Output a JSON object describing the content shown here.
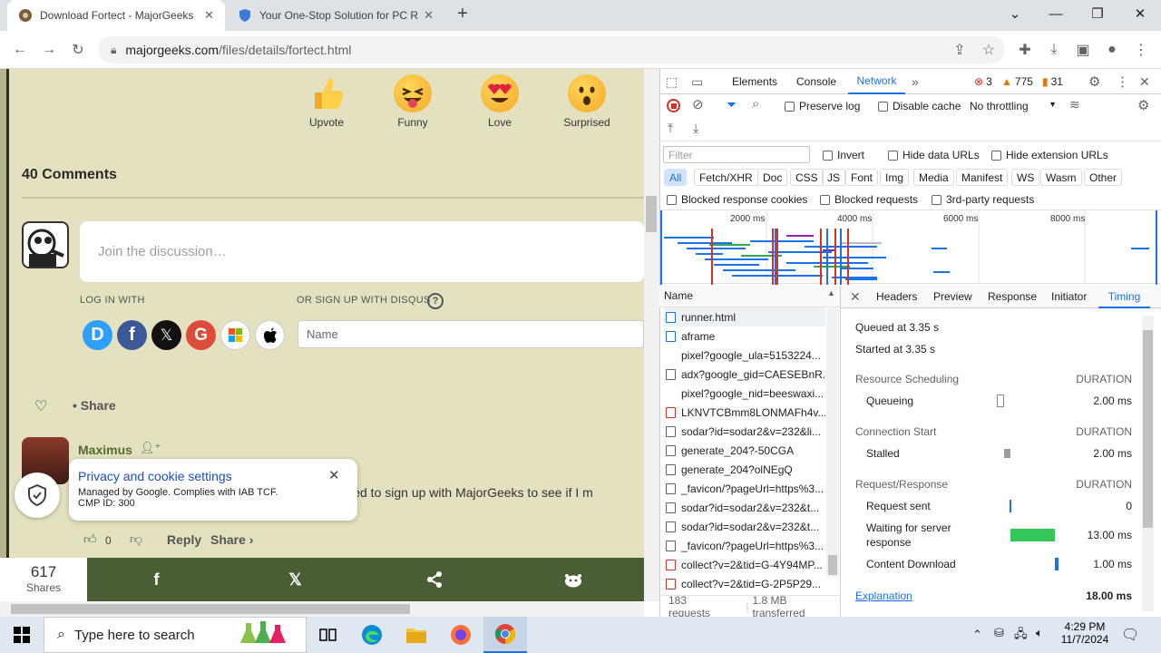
{
  "browser": {
    "tabs": [
      {
        "title": "Download Fortect - MajorGeeks",
        "active": true
      },
      {
        "title": "Your One-Stop Solution for PC R",
        "active": false
      }
    ],
    "url_host": "majorgeeks.com",
    "url_path": "/files/details/fortect.html"
  },
  "page": {
    "reactions": [
      "Upvote",
      "Funny",
      "Love",
      "Surprised"
    ],
    "comments_heading": "40 Comments",
    "discussion_placeholder": "Join the discussion…",
    "login_with": "LOG IN WITH",
    "signup_with": "OR SIGN UP WITH DISQUS",
    "help_glyph": "?",
    "name_placeholder": "Name",
    "share_label": "Share",
    "comment": {
      "author": "Maximus",
      "text_fragment": ". I tried to sign up with MajorGeeks to see if I m",
      "votes": "0",
      "reply": "Reply",
      "share": "Share ›"
    },
    "privacy": {
      "title": "Privacy and cookie settings",
      "line1": "Managed by Google. Complies with IAB TCF.",
      "line2": "CMP ID: 300"
    },
    "shares_count": "617",
    "shares_label": "Shares"
  },
  "devtools": {
    "tabs": [
      "Elements",
      "Console",
      "Network"
    ],
    "active_tab": "Network",
    "errors": "3",
    "warnings": "775",
    "issues": "31",
    "preserve_log": "Preserve log",
    "disable_cache": "Disable cache",
    "throttling": "No throttling",
    "filter_placeholder": "Filter",
    "invert": "Invert",
    "hide_data_urls": "Hide data URLs",
    "hide_ext_urls": "Hide extension URLs",
    "type_filters": [
      "All",
      "Fetch/XHR",
      "Doc",
      "CSS",
      "JS",
      "Font",
      "Img",
      "Media",
      "Manifest",
      "WS",
      "Wasm",
      "Other"
    ],
    "blocked_cookies": "Blocked response cookies",
    "blocked_requests": "Blocked requests",
    "third_party": "3rd-party requests",
    "timeline_ticks": [
      "2000 ms",
      "4000 ms",
      "6000 ms",
      "8000 ms"
    ],
    "name_header": "Name",
    "requests": [
      {
        "name": "runner.html",
        "icon": "blue"
      },
      {
        "name": "aframe",
        "icon": "blue"
      },
      {
        "name": "pixel?google_ula=5153224...",
        "icon": "none"
      },
      {
        "name": "adx?google_gid=CAESEBnR...",
        "icon": "grey"
      },
      {
        "name": "pixel?google_nid=beeswaxi...",
        "icon": "none"
      },
      {
        "name": "LKNVTCBmm8LONMAFh4v...",
        "icon": "red"
      },
      {
        "name": "sodar?id=sodar2&v=232&li...",
        "icon": "grey"
      },
      {
        "name": "generate_204?-50CGA",
        "icon": "grey"
      },
      {
        "name": "generate_204?olNEgQ",
        "icon": "grey"
      },
      {
        "name": "_favicon/?pageUrl=https%3...",
        "icon": "grey"
      },
      {
        "name": "sodar?id=sodar2&v=232&t...",
        "icon": "grey"
      },
      {
        "name": "sodar?id=sodar2&v=232&t...",
        "icon": "grey"
      },
      {
        "name": "_favicon/?pageUrl=https%3...",
        "icon": "grey"
      },
      {
        "name": "collect?v=2&tid=G-4Y94MP...",
        "icon": "red"
      },
      {
        "name": "collect?v=2&tid=G-2P5P29...",
        "icon": "red"
      }
    ],
    "detail_tabs": [
      "Headers",
      "Preview",
      "Response",
      "Initiator",
      "Timing"
    ],
    "active_detail_tab": "Timing",
    "queued_at": "Queued at 3.35 s",
    "started_at": "Started at 3.35 s",
    "duration_label": "DURATION",
    "sections": {
      "resource_scheduling": "Resource Scheduling",
      "connection_start": "Connection Start",
      "request_response": "Request/Response"
    },
    "timings": {
      "queueing": {
        "label": "Queueing",
        "value": "2.00 ms"
      },
      "stalled": {
        "label": "Stalled",
        "value": "2.00 ms"
      },
      "request_sent": {
        "label": "Request sent",
        "value": "0"
      },
      "waiting": {
        "label": "Waiting for server response",
        "value": "13.00 ms"
      },
      "download": {
        "label": "Content Download",
        "value": "1.00 ms"
      }
    },
    "explanation": "Explanation",
    "total": "18.00 ms",
    "requests_count": "183 requests",
    "transferred": "1.8 MB transferred"
  },
  "taskbar": {
    "search_placeholder": "Type here to search",
    "time": "4:29 PM",
    "date": "11/7/2024"
  },
  "colors": {
    "page_bg": "#e3e1bf",
    "share_bar": "#4a5d34",
    "devtools_accent": "#1a73e8",
    "waiting_bar": "#34c759"
  }
}
